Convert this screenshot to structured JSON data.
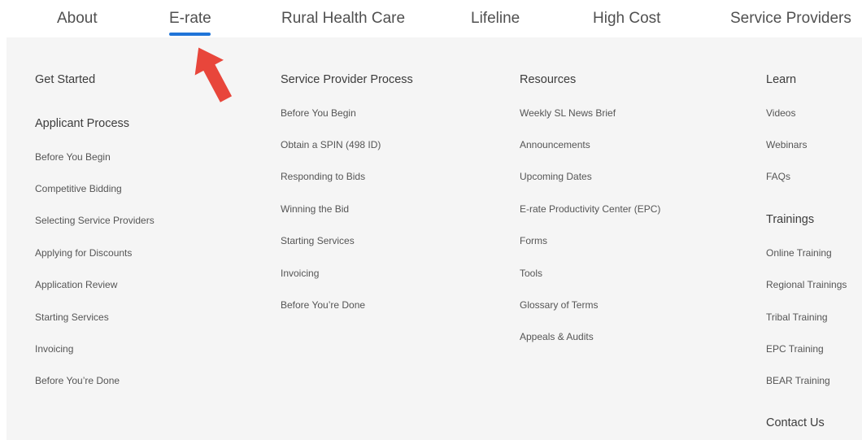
{
  "nav": {
    "items": [
      {
        "label": "About"
      },
      {
        "label": "E-rate"
      },
      {
        "label": "Rural Health Care"
      },
      {
        "label": "Lifeline"
      },
      {
        "label": "High Cost"
      },
      {
        "label": "Service Providers"
      }
    ],
    "active": "E-rate",
    "accent_color": "#1f74d8"
  },
  "menu": {
    "col1": {
      "get_started": "Get Started",
      "heading": "Applicant Process",
      "links": [
        "Before You Begin",
        "Competitive Bidding",
        "Selecting Service Providers",
        "Applying for Discounts",
        "Application Review",
        "Starting Services",
        "Invoicing",
        "Before You’re Done"
      ]
    },
    "col2": {
      "heading": "Service Provider Process",
      "links": [
        "Before You Begin",
        "Obtain a SPIN (498 ID)",
        "Responding to Bids",
        "Winning the Bid",
        "Starting Services",
        "Invoicing",
        "Before You’re Done"
      ]
    },
    "col3": {
      "heading": "Resources",
      "links": [
        "Weekly SL News Brief",
        "Announcements",
        "Upcoming Dates",
        "E-rate Productivity Center (EPC)",
        "Forms",
        "Tools",
        "Glossary of Terms",
        "Appeals & Audits"
      ]
    },
    "col4": {
      "learn_heading": "Learn",
      "learn_links": [
        "Videos",
        "Webinars",
        "FAQs"
      ],
      "trainings_heading": "Trainings",
      "trainings_links": [
        "Online Training",
        "Regional Trainings",
        "Tribal Training",
        "EPC Training",
        "BEAR Training"
      ],
      "contact": "Contact Us"
    }
  },
  "annotation": {
    "arrow_color": "#e8463b"
  }
}
